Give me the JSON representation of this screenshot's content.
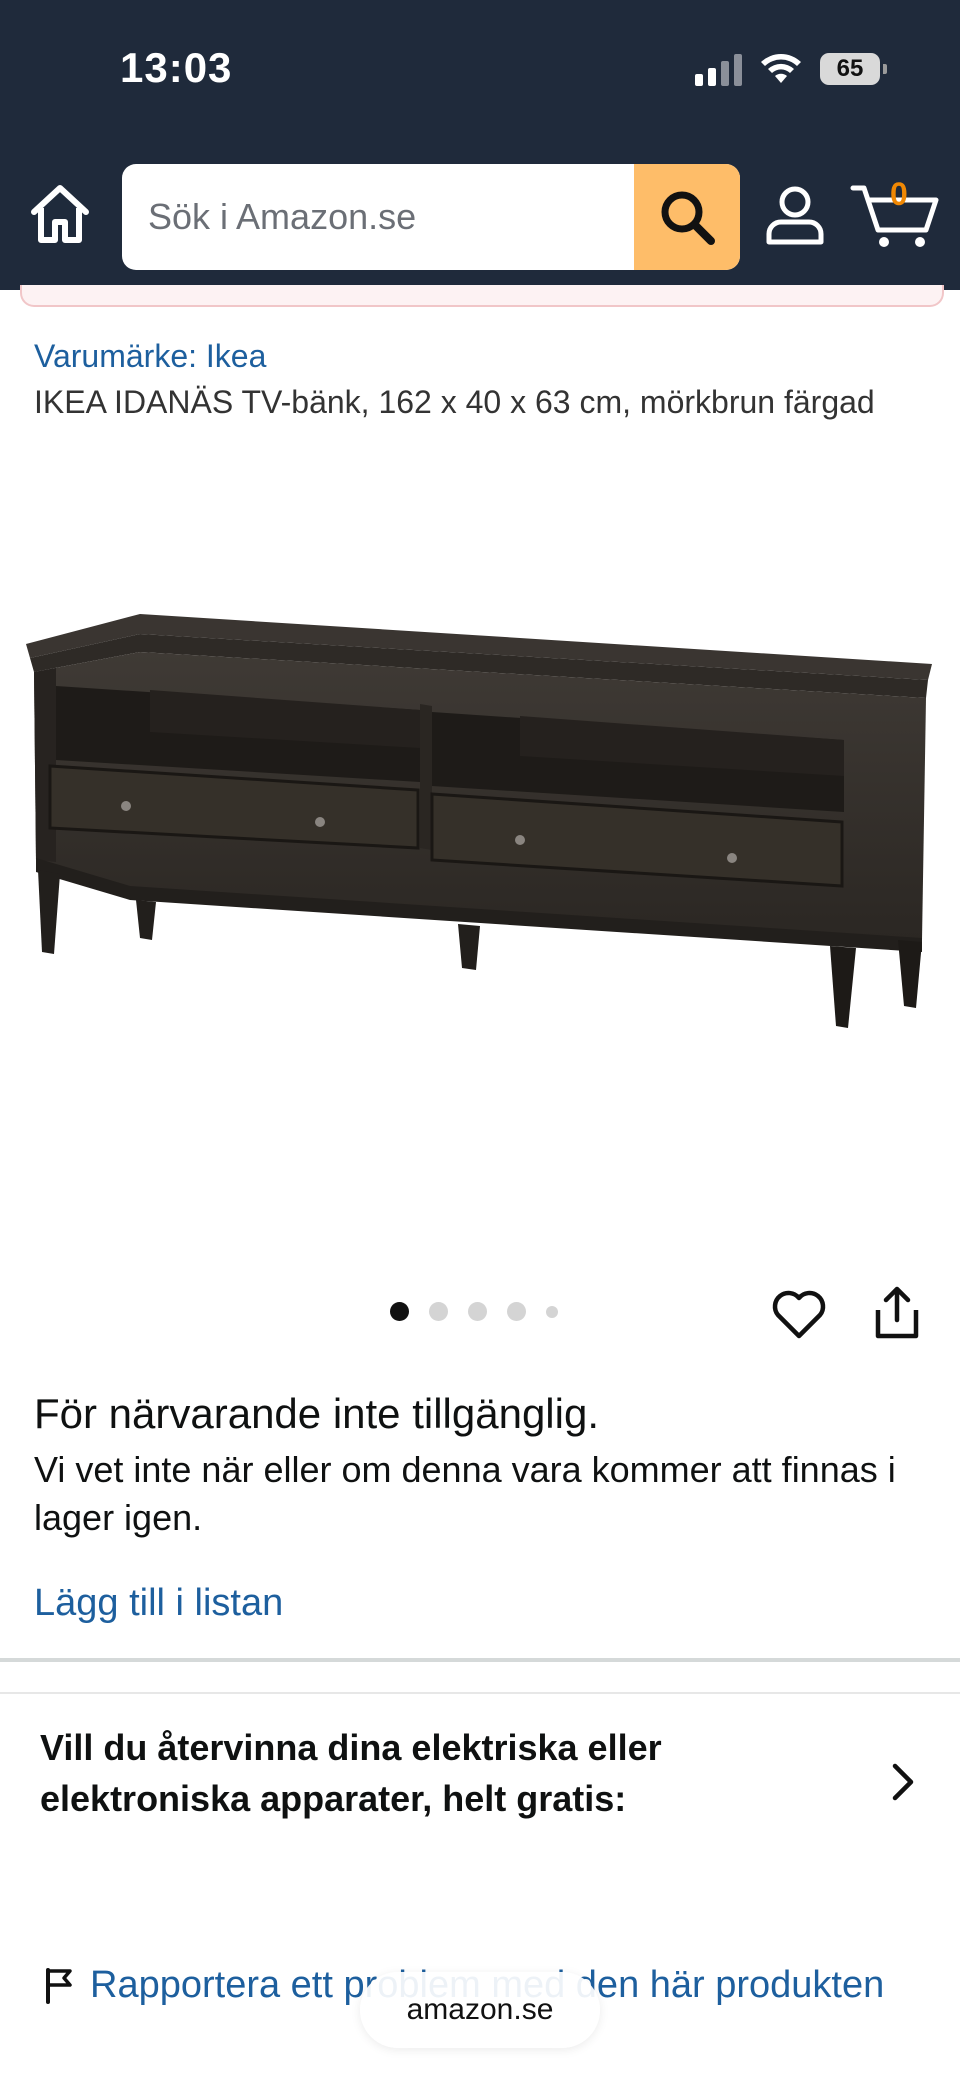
{
  "status_bar": {
    "time": "13:03",
    "battery": "65"
  },
  "header": {
    "search_placeholder": "Sök i Amazon.se",
    "cart_count": "0",
    "accent_color": "#febd69",
    "background_color": "#1f2a3b"
  },
  "product": {
    "brand": "Varumärke: Ikea",
    "title": "IKEA IDANÄS TV-bänk, 162 x 40 x 63 cm, mörkbrun färgad",
    "image_count": 5,
    "active_image": 1
  },
  "availability": {
    "title": "För närvarande inte tillgänglig.",
    "text": "Vi vet inte när eller om denna vara kommer att finnas i lager igen."
  },
  "actions": {
    "add_to_list": "Lägg till i listan"
  },
  "recycle": {
    "text": "Vill du återvinna dina elektriska eller elektroniska apparater, helt gratis:"
  },
  "report": {
    "text": "Rapportera ett problem med den här produkten"
  },
  "browser": {
    "url": "amazon.se"
  },
  "icons": [
    "home-icon",
    "search-icon",
    "user-icon",
    "cart-icon",
    "heart-icon",
    "share-icon",
    "chevron-right-icon",
    "flag-icon"
  ]
}
